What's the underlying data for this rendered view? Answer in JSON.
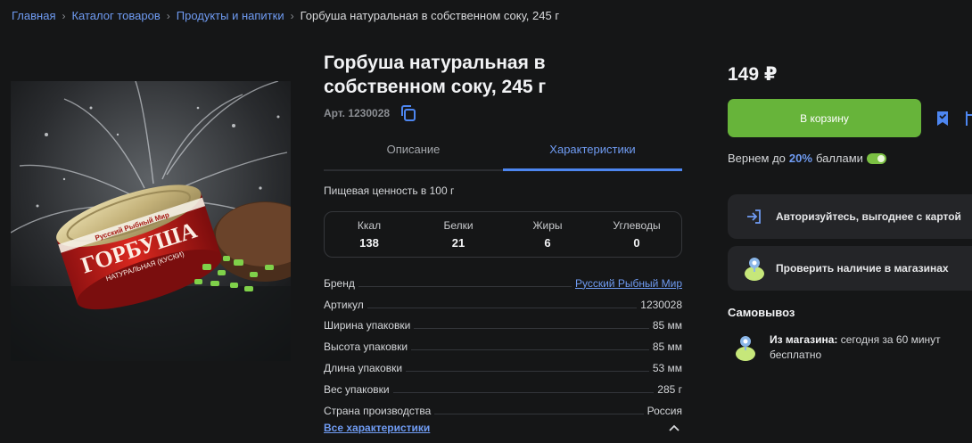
{
  "breadcrumbs": [
    "Главная",
    "Каталог товаров",
    "Продукты и напитки"
  ],
  "breadcrumb_current": "Горбуша натуральная в собственном соку, 245 г",
  "product": {
    "title": "Горбуша натуральная в собственном соку, 245 г",
    "article_label": "Арт. 1230028",
    "can_brand": "Русский Рыбный Мир",
    "can_name": "ГОРБУША",
    "can_sub": "НАТУРАЛЬНАЯ (КУСКИ)"
  },
  "tabs": {
    "description": "Описание",
    "characteristics": "Характеристики",
    "active": "characteristics"
  },
  "nutrition": {
    "title": "Пищевая ценность в 100 г",
    "cells": [
      {
        "label": "Ккал",
        "value": "138"
      },
      {
        "label": "Белки",
        "value": "21"
      },
      {
        "label": "Жиры",
        "value": "6"
      },
      {
        "label": "Углеводы",
        "value": "0"
      }
    ]
  },
  "properties": [
    {
      "key": "Бренд",
      "value": "Русский Рыбный Мир",
      "link": true
    },
    {
      "key": "Артикул",
      "value": "1230028"
    },
    {
      "key": "Ширина упаковки",
      "value": "85 мм"
    },
    {
      "key": "Высота упаковки",
      "value": "85 мм"
    },
    {
      "key": "Длина упаковки",
      "value": "53 мм"
    },
    {
      "key": "Вес упаковки",
      "value": "285 г"
    },
    {
      "key": "Страна производства",
      "value": "Россия"
    }
  ],
  "all_characteristics": "Все характеристики",
  "buy": {
    "price": "149 ₽",
    "cart_label": "В корзину",
    "bonus_before": "Вернем до",
    "bonus_pct": "20%",
    "bonus_after": "баллами"
  },
  "cards": {
    "login": "Авторизуйтесь, выгоднее с картой",
    "stores": "Проверить наличие в магазинах"
  },
  "pickup": {
    "title": "Самовывоз",
    "from_label": "Из магазина:",
    "when": "сегодня за 60 минут",
    "cost": "бесплатно"
  },
  "colors": {
    "accent": "#6f9bf2",
    "button": "#67b43a",
    "background": "#151617",
    "card": "#242528"
  }
}
